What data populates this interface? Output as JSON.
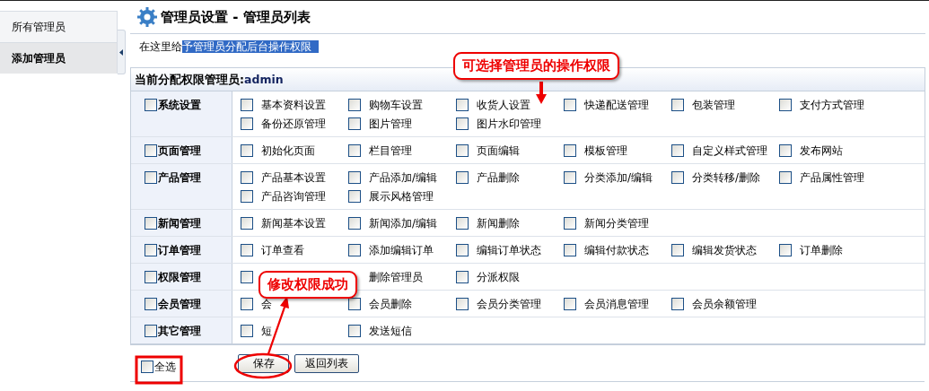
{
  "sidebar": {
    "items": [
      {
        "label": "所有管理员",
        "selected": false
      },
      {
        "label": "添加管理员",
        "selected": true
      }
    ]
  },
  "header": {
    "title": "管理员设置 - 管理员列表"
  },
  "intro": {
    "text": "在这里给",
    "selected_text": "予管理员分配后台操作权限"
  },
  "table": {
    "heading_label": "当前分配权限管理员:",
    "heading_value": "admin",
    "groups": [
      {
        "label": "系统设置",
        "checked": false,
        "items": [
          {
            "label": "基本资料设置",
            "checked": false
          },
          {
            "label": "购物车设置",
            "checked": false
          },
          {
            "label": "收货人设置",
            "checked": false
          },
          {
            "label": "快递配送管理",
            "checked": false
          },
          {
            "label": "包装管理",
            "checked": false
          },
          {
            "label": "支付方式管理",
            "checked": false
          },
          {
            "label": "备份还原管理",
            "checked": false
          },
          {
            "label": "图片管理",
            "checked": false
          },
          {
            "label": "图片水印管理",
            "checked": false
          }
        ]
      },
      {
        "label": "页面管理",
        "checked": false,
        "items": [
          {
            "label": "初始化页面",
            "checked": false
          },
          {
            "label": "栏目管理",
            "checked": false
          },
          {
            "label": "页面编辑",
            "checked": false
          },
          {
            "label": "模板管理",
            "checked": false
          },
          {
            "label": "自定义样式管理",
            "checked": false
          },
          {
            "label": "发布网站",
            "checked": false
          }
        ]
      },
      {
        "label": "产品管理",
        "checked": false,
        "items": [
          {
            "label": "产品基本设置",
            "checked": false
          },
          {
            "label": "产品添加/编辑",
            "checked": false
          },
          {
            "label": "产品删除",
            "checked": false
          },
          {
            "label": "分类添加/编辑",
            "checked": false
          },
          {
            "label": "分类转移/删除",
            "checked": false
          },
          {
            "label": "产品属性管理",
            "checked": false
          },
          {
            "label": "产品咨询管理",
            "checked": false
          },
          {
            "label": "展示风格管理",
            "checked": false
          }
        ]
      },
      {
        "label": "新闻管理",
        "checked": false,
        "items": [
          {
            "label": "新闻基本设置",
            "checked": false
          },
          {
            "label": "新闻添加/编辑",
            "checked": false
          },
          {
            "label": "新闻删除",
            "checked": false
          },
          {
            "label": "新闻分类管理",
            "checked": false
          }
        ]
      },
      {
        "label": "订单管理",
        "checked": false,
        "items": [
          {
            "label": "订单查看",
            "checked": false
          },
          {
            "label": "添加编辑订单",
            "checked": false
          },
          {
            "label": "编辑订单状态",
            "checked": false
          },
          {
            "label": "编辑付款状态",
            "checked": false
          },
          {
            "label": "编辑发货状态",
            "checked": false
          },
          {
            "label": "订单删除",
            "checked": false
          }
        ]
      },
      {
        "label": "权限管理",
        "checked": false,
        "items": [
          {
            "checked": false
          },
          {
            "label": "删除管理员"
          },
          {
            "label": "分派权限",
            "checked": false
          }
        ]
      },
      {
        "label": "会员管理",
        "checked": false,
        "items": [
          {
            "label": "会",
            "checked": false
          },
          {
            "label": "会员删除",
            "checked": false
          },
          {
            "label": "会员分类管理",
            "checked": false
          },
          {
            "label": "会员消息管理",
            "checked": false
          },
          {
            "label": "会员余额管理",
            "checked": false
          }
        ]
      },
      {
        "label": "其它管理",
        "checked": false,
        "items": [
          {
            "label": "短",
            "checked": false
          },
          {
            "label": "发送短信",
            "checked": false
          }
        ]
      }
    ]
  },
  "select_all": {
    "label": "全选",
    "checked": false
  },
  "buttons": [
    {
      "label": "保存"
    },
    {
      "label": "返回列表"
    }
  ],
  "annotations": [
    {
      "text": "可选择管理员的操作权限"
    },
    {
      "text": "修改权限成功"
    }
  ]
}
